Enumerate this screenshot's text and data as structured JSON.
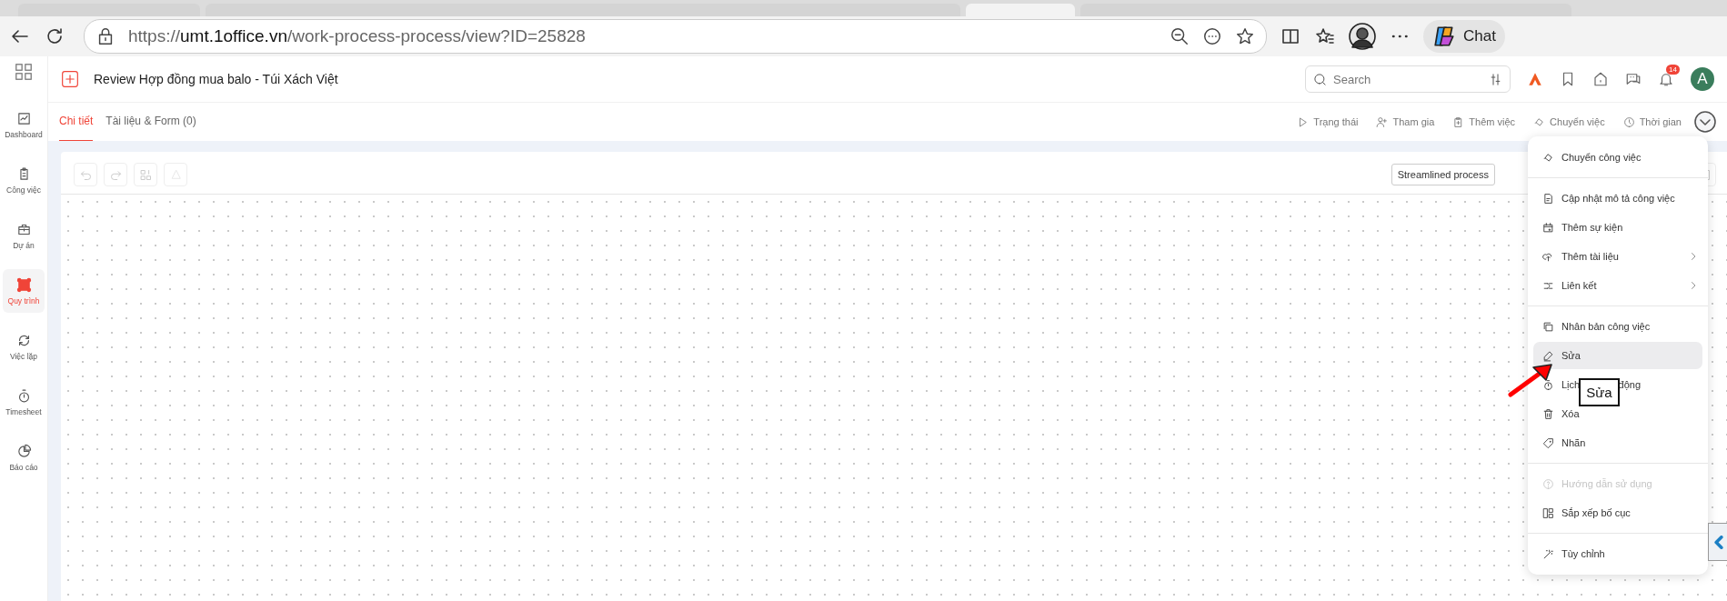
{
  "browser": {
    "tabs": [
      {
        "selected": false
      },
      {
        "selected": false
      },
      {
        "selected": true
      },
      {
        "selected": false
      }
    ],
    "url": {
      "scheme": "https://",
      "host": "umt.1office.vn",
      "path": "/work-process-process/view?ID=25828"
    },
    "chat_label": "Chat"
  },
  "header": {
    "title": "Review Hợp đồng mua balo - Túi Xách Việt",
    "search": {
      "placeholder": "Search"
    },
    "notification_count": "14",
    "avatar_letter": "A"
  },
  "sidebar": {
    "items": [
      {
        "label": "Dashboard",
        "selected": false
      },
      {
        "label": "Công việc",
        "selected": false
      },
      {
        "label": "Dự án",
        "selected": false
      },
      {
        "label": "Quy trình",
        "selected": true
      },
      {
        "label": "Việc lặp",
        "selected": false
      },
      {
        "label": "Timesheet",
        "selected": false
      },
      {
        "label": "Báo cáo",
        "selected": false
      }
    ]
  },
  "tabs": [
    {
      "label": "Chi tiết",
      "selected": true
    },
    {
      "label": "Tài liệu & Form (0)",
      "selected": false
    }
  ],
  "actions": [
    "Trạng thái",
    "Tham gia",
    "Thêm việc",
    "Chuyển việc",
    "Thời gian"
  ],
  "canvas": {
    "mode_button": "Streamlined process"
  },
  "menu": {
    "sections": [
      [
        {
          "label": "Chuyển công việc",
          "submenu": false,
          "disabled": false,
          "selected": false
        }
      ],
      [
        {
          "label": "Cập nhật mô tả công việc",
          "submenu": false,
          "disabled": false,
          "selected": false
        },
        {
          "label": "Thêm sự kiện",
          "submenu": false,
          "disabled": false,
          "selected": false
        },
        {
          "label": "Thêm tài liệu",
          "submenu": true,
          "disabled": false,
          "selected": false
        },
        {
          "label": "Liên kết",
          "submenu": true,
          "disabled": false,
          "selected": false
        }
      ],
      [
        {
          "label": "Nhân bản công việc",
          "submenu": false,
          "disabled": false,
          "selected": false
        },
        {
          "label": "Sửa",
          "submenu": false,
          "disabled": false,
          "selected": true
        },
        {
          "label": "Lịch",
          "label_after": "động",
          "tooltip": "Sửa",
          "submenu": false,
          "disabled": false,
          "selected": false
        },
        {
          "label": "Xóa",
          "submenu": false,
          "disabled": false,
          "selected": false
        },
        {
          "label": "Nhãn",
          "submenu": false,
          "disabled": false,
          "selected": false
        }
      ],
      [
        {
          "label": "Hướng dẫn sử dụng",
          "submenu": false,
          "disabled": true,
          "selected": false
        },
        {
          "label": "Sắp xếp bố cục",
          "submenu": false,
          "disabled": false,
          "selected": false
        }
      ],
      [
        {
          "label": "Tùy chỉnh",
          "submenu": false,
          "disabled": false,
          "selected": false
        }
      ]
    ]
  }
}
